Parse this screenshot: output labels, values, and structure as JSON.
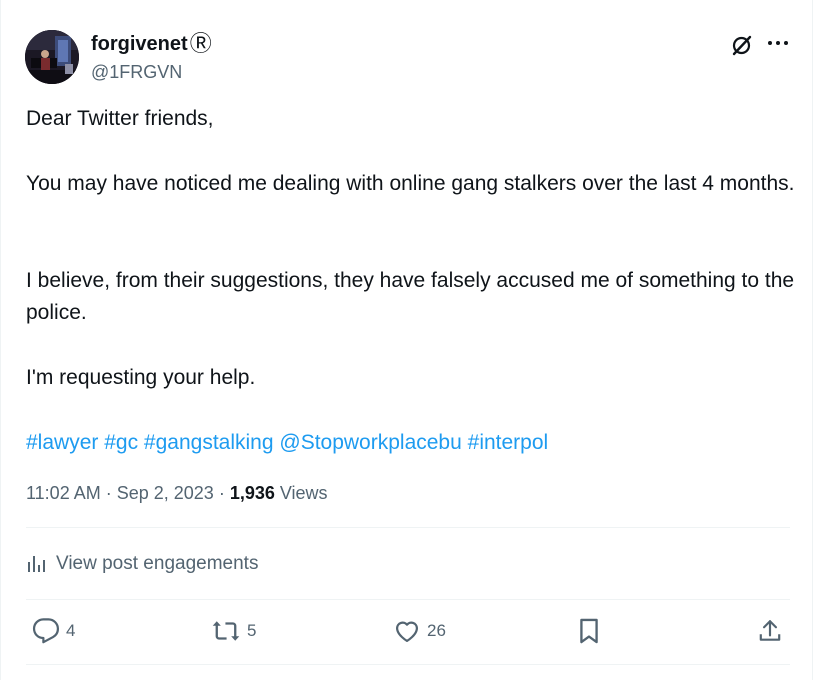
{
  "user": {
    "display_name": "forgivenet",
    "registered_mark": "Ⓡ",
    "handle": "@1FRGVN"
  },
  "tweet": {
    "p1": "Dear Twitter friends,",
    "p2": "You may have noticed me dealing with online gang stalkers over the last 4 months.",
    "p3": "I believe, from their suggestions, they have falsely accused me of something to the police.",
    "p4": "I'm requesting your help.",
    "tags": [
      "#lawyer",
      "#gc",
      "#gangstalking",
      "@Stopworkplacebu",
      "#interpol"
    ]
  },
  "meta": {
    "time": "11:02 AM",
    "sep1": " · ",
    "date": "Sep 2, 2023",
    "sep2": " · ",
    "views_count": "1,936",
    "views_label": " Views"
  },
  "engagements_label": "View post engagements",
  "actions": {
    "reply_count": "4",
    "repost_count": "5",
    "like_count": "26"
  },
  "icons": {
    "grok": "grok-icon",
    "more": "more-icon",
    "analytics": "analytics-icon",
    "reply": "reply-icon",
    "repost": "repost-icon",
    "like": "like-icon",
    "bookmark": "bookmark-icon",
    "share": "share-icon"
  },
  "colors": {
    "link": "#1d9bf0",
    "secondary_text": "#536471",
    "primary_text": "#0f1419",
    "divider": "#eff3f4"
  }
}
